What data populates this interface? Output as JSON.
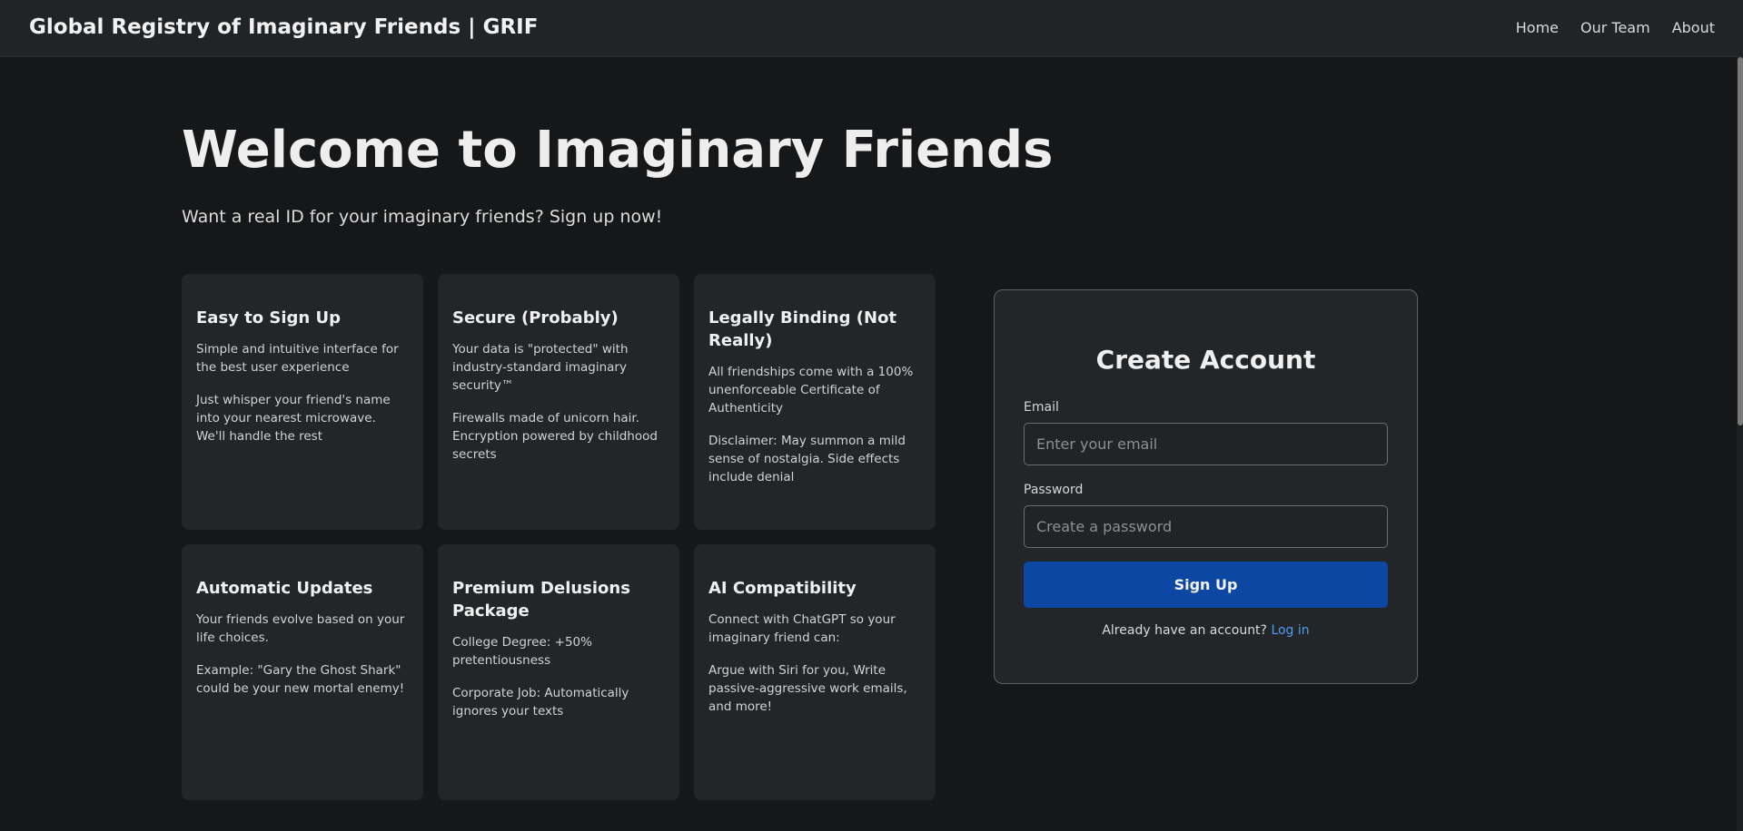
{
  "navbar": {
    "brand": "Global Registry of Imaginary Friends | GRIF",
    "links": [
      "Home",
      "Our Team",
      "About"
    ]
  },
  "hero": {
    "title": "Welcome to Imaginary Friends",
    "subtitle": "Want a real ID for your imaginary friends? Sign up now!"
  },
  "features": [
    {
      "title": "Easy to Sign Up",
      "paragraphs": [
        "Simple and intuitive interface for the best user experience",
        "Just whisper your friend's name into your nearest microwave. We'll handle the rest"
      ]
    },
    {
      "title": "Secure (Probably)",
      "paragraphs": [
        "Your data is \"protected\" with industry-standard imaginary security™",
        "Firewalls made of unicorn hair. Encryption powered by childhood secrets"
      ]
    },
    {
      "title": "Legally Binding (Not Really)",
      "paragraphs": [
        "All friendships come with a 100% unenforceable Certificate of Authenticity",
        "Disclaimer: May summon a mild sense of nostalgia. Side effects include denial"
      ]
    },
    {
      "title": "Automatic Updates",
      "paragraphs": [
        "Your friends evolve based on your life choices.",
        "Example: \"Gary the Ghost Shark\" could be your new mortal enemy!"
      ]
    },
    {
      "title": "Premium Delusions Package",
      "paragraphs": [
        "College Degree: +50% pretentiousness",
        "Corporate Job: Automatically ignores your texts"
      ]
    },
    {
      "title": "AI Compatibility",
      "paragraphs": [
        "Connect with ChatGPT so your imaginary friend can:",
        "Argue with Siri for you, Write passive-aggressive work emails, and more!"
      ]
    }
  ],
  "signup": {
    "title": "Create Account",
    "email_label": "Email",
    "email_placeholder": "Enter your email",
    "email_value": "",
    "password_label": "Password",
    "password_placeholder": "Create a password",
    "password_value": "",
    "submit_label": "Sign Up",
    "login_prompt": "Already have an account?",
    "login_link": "Log in"
  },
  "colors": {
    "background": "#151719",
    "navbar": "#212426",
    "card": "#232628",
    "primary_button": "#0b47a3",
    "link": "#4e9cf5"
  }
}
